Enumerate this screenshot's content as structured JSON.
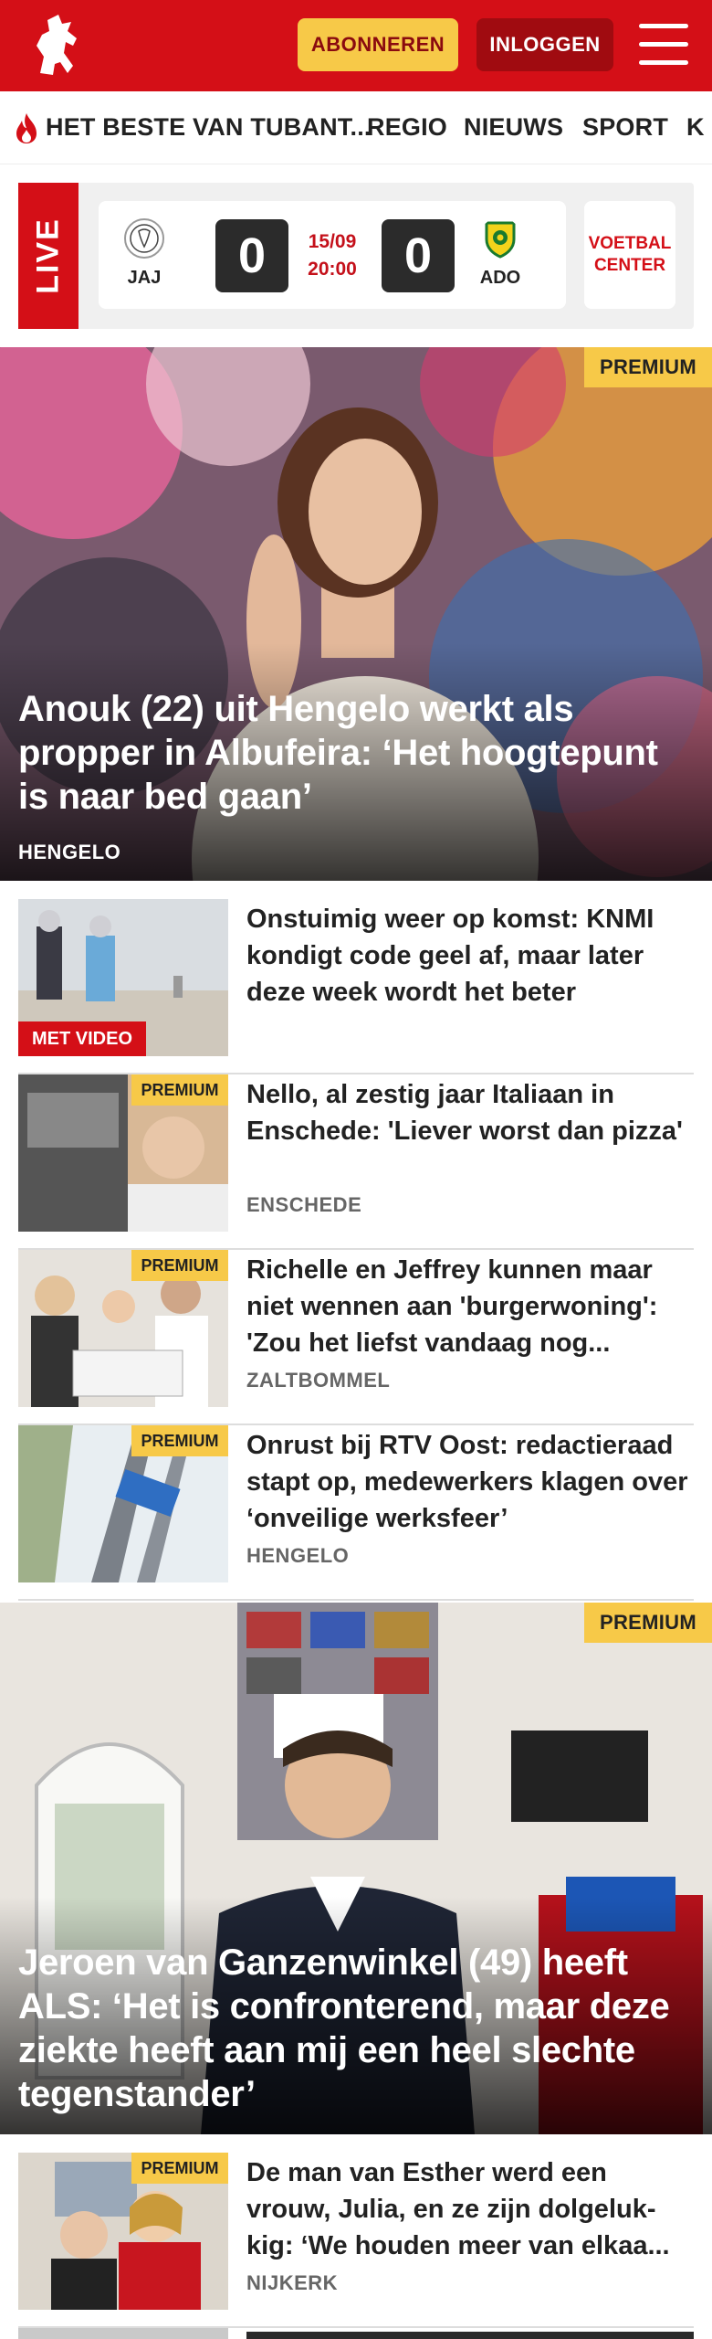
{
  "header": {
    "subscribe_label": "ABONNEREN",
    "login_label": "INLOGGEN"
  },
  "nav": {
    "items": [
      "HET BESTE VAN TUBANT...",
      "REGIO",
      "NIEUWS",
      "SPORT",
      "K"
    ]
  },
  "live": {
    "label": "LIVE",
    "home_team": "JAJ",
    "away_team": "ADO",
    "home_score": "0",
    "away_score": "0",
    "date": "15/09",
    "time": "20:00",
    "center_line1": "VOETBAL",
    "center_line2": "CENTER"
  },
  "hero1": {
    "badge": "PREMIUM",
    "title": "Anouk (22) uit Hengelo werkt als propper in Albufeira: ‘Het hoogtepunt is naar bed gaan’",
    "location": "HENGELO"
  },
  "articles": [
    {
      "title": "Onstuimig weer op komst: KNMI kondigt code geel af, maar later deze week wordt het beter",
      "location": "",
      "badge": "",
      "video_badge": "MET VIDEO"
    },
    {
      "title": "Nello, al zestig jaar Italiaan in Enschede: 'Liever worst dan pizza'",
      "location": "ENSCHEDE",
      "badge": "PREMIUM",
      "video_badge": ""
    },
    {
      "title": "Richelle en Jeffrey kunnen maar niet wennen aan 'burgerwoning': 'Zou het liefst vandaag nog...",
      "location": "ZALTBOMMEL",
      "badge": "PREMIUM",
      "video_badge": ""
    },
    {
      "title": "Onrust bij RTV Oost: redactieraad stapt op, medewerkers klagen over ‘onveilige werksfeer’",
      "location": "HENGELO",
      "badge": "PREMIUM",
      "video_badge": ""
    }
  ],
  "hero2": {
    "badge": "PREMIUM",
    "title": "Jeroen van Ganzenwinkel (49) heeft ALS: ‘Het is confronterend, maar deze ziekte heeft aan mij een heel slechte tegenstander’"
  },
  "article5": {
    "badge": "PREMIUM",
    "title": "De man van Esther werd een vrouw, Julia, en ze zijn dolgeluk-kig: ‘We houden meer van elkaa...",
    "location": "NIJKERK"
  },
  "colors": {
    "brand_red": "#d40f17",
    "premium_yellow": "#f7c948",
    "score_dark": "#2b2b2b"
  }
}
